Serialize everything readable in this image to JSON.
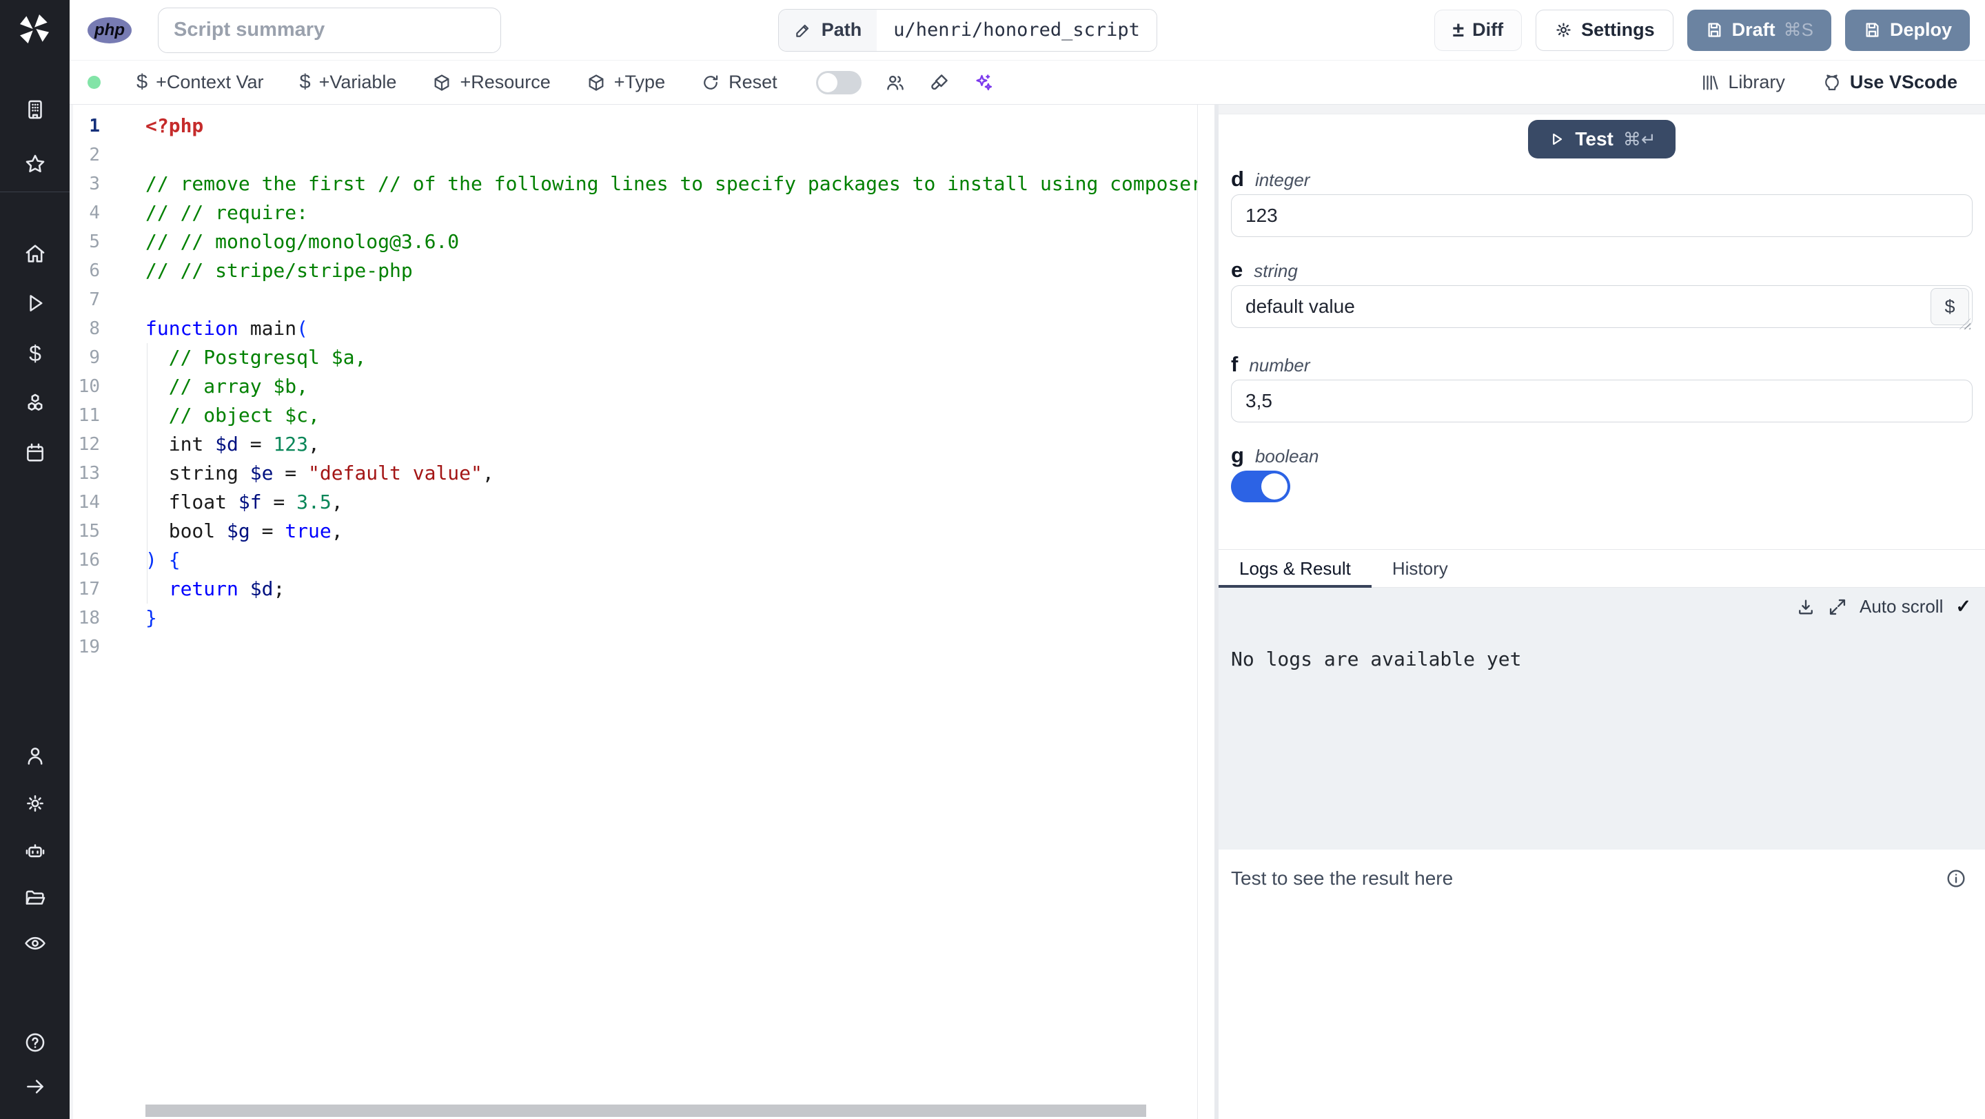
{
  "topbar": {
    "language_badge": "php",
    "summary_placeholder": "Script summary",
    "path": {
      "label": "Path",
      "value": "u/henri/honored_script"
    },
    "buttons": {
      "diff": "Diff",
      "settings": "Settings",
      "draft": "Draft",
      "draft_shortcut": "⌘S",
      "deploy": "Deploy"
    }
  },
  "toolbar": {
    "add_context_var": "+Context Var",
    "add_variable": "+Variable",
    "add_resource": "+Resource",
    "add_type": "+Type",
    "reset": "Reset",
    "library": "Library",
    "use_vscode": "Use VScode"
  },
  "glyphs": {
    "diff_icon": "±",
    "dollar": "$",
    "check": "✓",
    "cmd_enter": "⌘↵"
  },
  "editor": {
    "language": "php",
    "lines": [
      {
        "n": 1,
        "tokens": [
          {
            "t": "<?php",
            "c": "mt"
          }
        ]
      },
      {
        "n": 2,
        "tokens": []
      },
      {
        "n": 3,
        "tokens": [
          {
            "t": "// remove the first // of the following lines to specify packages to install using composer",
            "c": "cm"
          }
        ]
      },
      {
        "n": 4,
        "tokens": [
          {
            "t": "// // require:",
            "c": "cm"
          }
        ]
      },
      {
        "n": 5,
        "tokens": [
          {
            "t": "// // monolog/monolog@3.6.0",
            "c": "cm"
          }
        ]
      },
      {
        "n": 6,
        "tokens": [
          {
            "t": "// // stripe/stripe-php",
            "c": "cm"
          }
        ]
      },
      {
        "n": 7,
        "tokens": []
      },
      {
        "n": 8,
        "tokens": [
          {
            "t": "function",
            "c": "kw"
          },
          {
            "t": " main",
            "c": "pl"
          },
          {
            "t": "(",
            "c": "pu"
          }
        ]
      },
      {
        "n": 9,
        "tokens": [
          {
            "t": "  ",
            "c": "pl"
          },
          {
            "t": "// Postgresql $a,",
            "c": "cm"
          }
        ]
      },
      {
        "n": 10,
        "tokens": [
          {
            "t": "  ",
            "c": "pl"
          },
          {
            "t": "// array $b,",
            "c": "cm"
          }
        ]
      },
      {
        "n": 11,
        "tokens": [
          {
            "t": "  ",
            "c": "pl"
          },
          {
            "t": "// object $c,",
            "c": "cm"
          }
        ]
      },
      {
        "n": 12,
        "tokens": [
          {
            "t": "  int ",
            "c": "pl"
          },
          {
            "t": "$d",
            "c": "vr"
          },
          {
            "t": " = ",
            "c": "pl"
          },
          {
            "t": "123",
            "c": "nm"
          },
          {
            "t": ",",
            "c": "pl"
          }
        ]
      },
      {
        "n": 13,
        "tokens": [
          {
            "t": "  string ",
            "c": "pl"
          },
          {
            "t": "$e",
            "c": "vr"
          },
          {
            "t": " = ",
            "c": "pl"
          },
          {
            "t": "\"default value\"",
            "c": "st"
          },
          {
            "t": ",",
            "c": "pl"
          }
        ]
      },
      {
        "n": 14,
        "tokens": [
          {
            "t": "  float ",
            "c": "pl"
          },
          {
            "t": "$f",
            "c": "vr"
          },
          {
            "t": " = ",
            "c": "pl"
          },
          {
            "t": "3.5",
            "c": "nm"
          },
          {
            "t": ",",
            "c": "pl"
          }
        ]
      },
      {
        "n": 15,
        "tokens": [
          {
            "t": "  bool ",
            "c": "pl"
          },
          {
            "t": "$g",
            "c": "vr"
          },
          {
            "t": " = ",
            "c": "pl"
          },
          {
            "t": "true",
            "c": "kw"
          },
          {
            "t": ",",
            "c": "pl"
          }
        ]
      },
      {
        "n": 16,
        "tokens": [
          {
            "t": ") {",
            "c": "pu"
          }
        ]
      },
      {
        "n": 17,
        "tokens": [
          {
            "t": "  ",
            "c": "pl"
          },
          {
            "t": "return",
            "c": "kw"
          },
          {
            "t": " ",
            "c": "pl"
          },
          {
            "t": "$d",
            "c": "vr"
          },
          {
            "t": ";",
            "c": "pl"
          }
        ]
      },
      {
        "n": 18,
        "tokens": [
          {
            "t": "}",
            "c": "pu"
          }
        ]
      },
      {
        "n": 19,
        "tokens": []
      }
    ]
  },
  "run_panel": {
    "test_button": {
      "label": "Test",
      "shortcut": "⌘↵"
    },
    "fields": [
      {
        "name": "d",
        "type": "integer",
        "value": "123"
      },
      {
        "name": "e",
        "type": "string",
        "value": "default value"
      },
      {
        "name": "f",
        "type": "number",
        "value": "3,5"
      },
      {
        "name": "g",
        "type": "boolean",
        "value": true
      }
    ],
    "tabs": {
      "logs": "Logs & Result",
      "history": "History"
    },
    "logs": {
      "autoscroll_label": "Auto scroll",
      "empty_message": "No logs are available yet"
    },
    "result": {
      "placeholder": "Test to see the result here"
    }
  },
  "colors": {
    "php_badge": "#777bb3",
    "test_button": "#394a66",
    "deploy_button": "#6b83a1",
    "toggle_on": "#2c63e5",
    "status_dot": "#82e4a7",
    "sparkles": "#7c3aed",
    "active_tab_underline": "#38435a"
  }
}
